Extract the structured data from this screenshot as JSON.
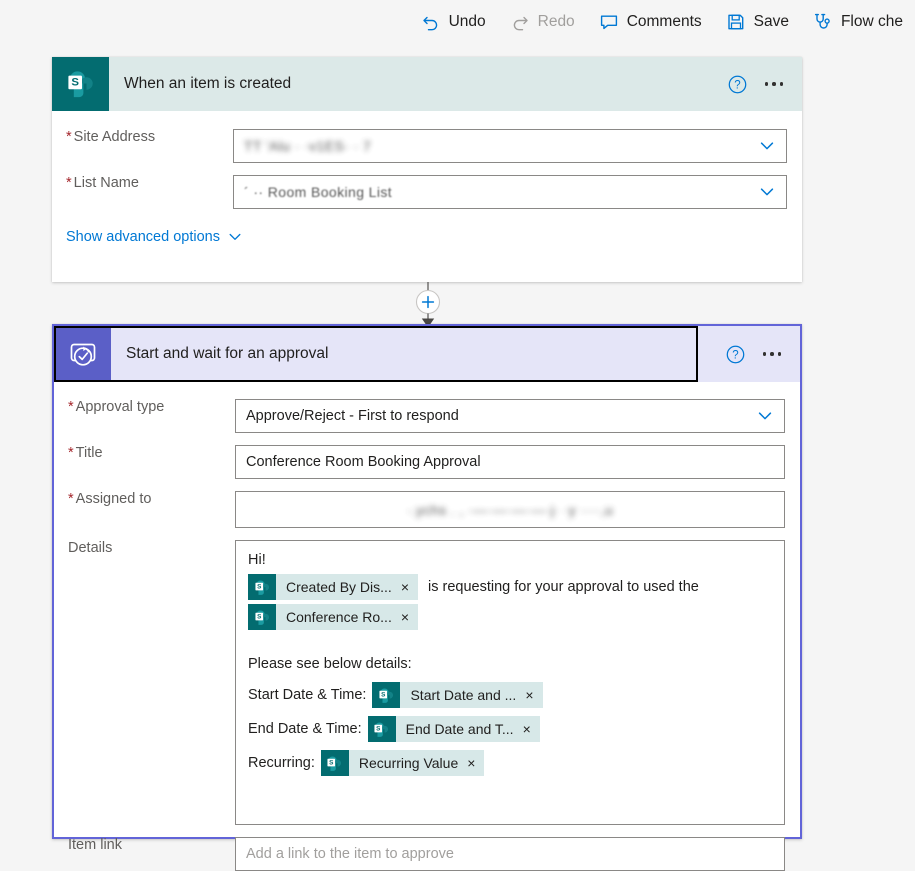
{
  "toolbar": {
    "items": [
      {
        "label": "Undo",
        "icon": "undo-icon",
        "disabled": false
      },
      {
        "label": "Redo",
        "icon": "redo-icon",
        "disabled": true
      },
      {
        "label": "Comments",
        "icon": "comment-icon",
        "disabled": false
      },
      {
        "label": "Save",
        "icon": "save-icon",
        "disabled": false
      },
      {
        "label": "Flow che",
        "icon": "flow-checker-icon",
        "disabled": false
      }
    ]
  },
  "trigger_card": {
    "title": "When an item is created",
    "icon": "sharepoint-icon",
    "help_label": "?",
    "fields": {
      "site_address": {
        "label": "Site Address",
        "required": true,
        "value": "TT   'Alu             ·       ·v1ES·  ·     7",
        "redacted": true
      },
      "list_name": {
        "label": "List Name",
        "required": true,
        "value": "´      ··  Room Booking List",
        "redacted": true
      }
    },
    "advanced_options_label": "Show advanced options"
  },
  "connector": {
    "add_step_label": "+"
  },
  "approval_card": {
    "title": "Start and wait for an approval",
    "icon": "approvals-icon",
    "selected": true,
    "fields": {
      "approval_type": {
        "label": "Approval type",
        "required": true,
        "value": "Approve/Reject - First to respond"
      },
      "title": {
        "label": "Title",
        "required": true,
        "value": "Conference Room Booking Approval"
      },
      "assigned_to": {
        "label": "Assigned to",
        "required": true,
        "value": "·.ychs   .  ,  ·—·—·—·—·j·  ·y    ····,u",
        "redacted": true
      },
      "details": {
        "label": "Details",
        "required": false,
        "greeting": "Hi!",
        "sentence_after_first_token": "is requesting for your approval to used the",
        "subheading": "Please see below details:",
        "tokens_inline": [
          {
            "label": "Created By Dis...",
            "icon": "sharepoint-icon",
            "remove": "×"
          },
          {
            "label": "Conference Ro...",
            "icon": "sharepoint-icon",
            "remove": "×"
          }
        ],
        "detail_rows": [
          {
            "label": "Start Date & Time:",
            "token": {
              "label": "Start Date and ...",
              "icon": "sharepoint-icon",
              "remove": "×"
            }
          },
          {
            "label": "End Date & Time:",
            "token": {
              "label": "End Date and T...",
              "icon": "sharepoint-icon",
              "remove": "×"
            }
          },
          {
            "label": "Recurring:",
            "token": {
              "label": "Recurring Value",
              "icon": "sharepoint-icon",
              "remove": "×"
            }
          }
        ]
      },
      "item_link": {
        "label": "Item link",
        "required": false,
        "placeholder": "Add a link to the item to approve",
        "value": ""
      }
    }
  },
  "colors": {
    "sharepoint_teal": "#036c70",
    "sharepoint_header": "#dce9e8",
    "approvals_purple": "#5b5fc7",
    "approvals_header": "#e5e5f8",
    "selection_border": "#6264d8",
    "link_blue": "#0078d4",
    "required_red": "#a4262c",
    "canvas": "#f5f5f5"
  }
}
